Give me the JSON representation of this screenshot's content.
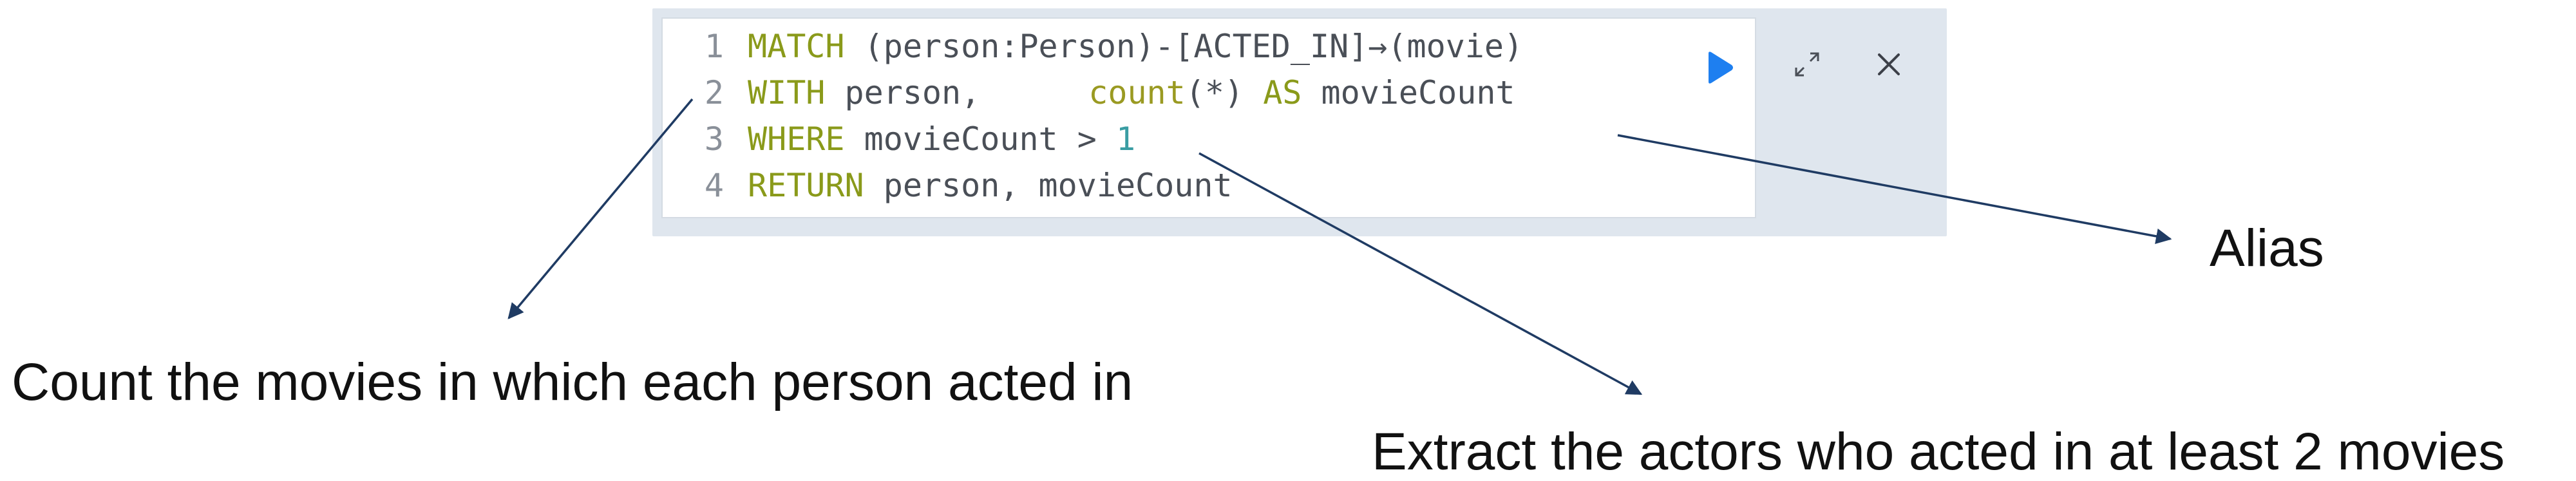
{
  "editor": {
    "lines": [
      {
        "number": "1",
        "parts": [
          {
            "t": "MATCH",
            "c": "kw"
          },
          {
            "t": " (person:Person)-[ACTED_IN]→(movie)",
            "c": "txt"
          }
        ]
      },
      {
        "number": "2",
        "parts": [
          {
            "t": "WITH",
            "c": "kw"
          },
          {
            "t": " person,",
            "c": "txt"
          },
          {
            "t": "GAP",
            "c": "gap"
          },
          {
            "t": "count",
            "c": "fn"
          },
          {
            "t": "(*) ",
            "c": "txt"
          },
          {
            "t": "AS",
            "c": "kw"
          },
          {
            "t": " movieCount",
            "c": "txt"
          }
        ]
      },
      {
        "number": "3",
        "parts": [
          {
            "t": "WHERE",
            "c": "kw"
          },
          {
            "t": " movieCount > ",
            "c": "txt"
          },
          {
            "t": "1",
            "c": "num"
          }
        ]
      },
      {
        "number": "4",
        "parts": [
          {
            "t": "RETURN",
            "c": "kw"
          },
          {
            "t": " person, movieCount",
            "c": "txt"
          }
        ]
      }
    ],
    "toolbar": {
      "run_icon": "play-icon",
      "expand_icon": "expand-icon",
      "close_icon": "close-icon",
      "accent": "#1e7ff0"
    }
  },
  "annotations": {
    "alias": "Alias",
    "count_movies": "Count the movies in which each person acted in",
    "extract_actors": "Extract the actors who acted in at least 2 movies"
  },
  "colors": {
    "keyword": "#8a9a1a",
    "number": "#3a9da3",
    "text": "#4a4f57",
    "arrow": "#1f3b63"
  }
}
